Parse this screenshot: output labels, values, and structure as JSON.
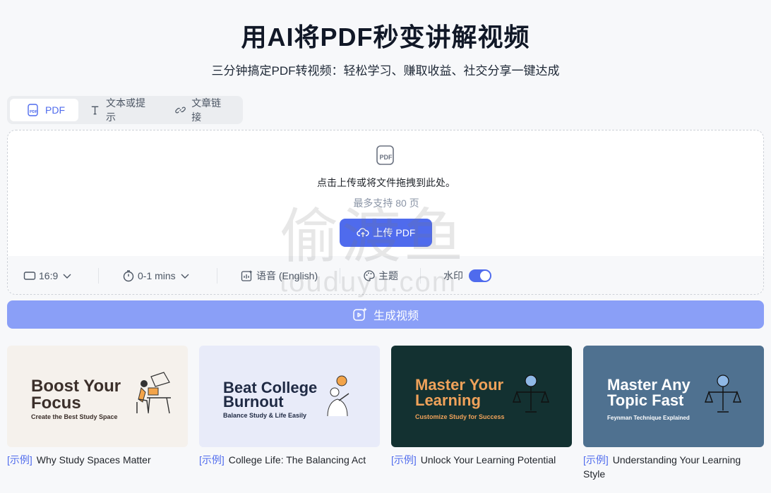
{
  "header": {
    "title": "用AI将PDF秒变讲解视频",
    "subtitle": "三分钟搞定PDF转视频：轻松学习、赚取收益、社交分享一键达成"
  },
  "tabs": [
    {
      "label": "PDF",
      "icon": "pdf-icon",
      "active": true
    },
    {
      "label": "文本或提示",
      "icon": "text-icon",
      "active": false
    },
    {
      "label": "文章链接",
      "icon": "link-icon",
      "active": false
    }
  ],
  "upload": {
    "instruction": "点击上传或将文件拖拽到此处。",
    "hint": "最多支持 80 页",
    "button_label": "上传 PDF"
  },
  "options": {
    "ratio": "16:9",
    "duration": "0-1 mins",
    "voice": "语音 (English)",
    "theme": "主题",
    "watermark_label": "水印",
    "watermark_on": true
  },
  "generate_label": "生成视频",
  "watermark_overlay": {
    "cn": "偷渡鱼",
    "en": "touduyu.com"
  },
  "examples": [
    {
      "tag": "[示例]",
      "caption": "Why Study Spaces Matter",
      "thumb_title_1": "Boost Your",
      "thumb_title_2": "Focus",
      "thumb_sub": "Create the Best Study Space",
      "bg": "#f5f1ec",
      "fg": "#3b2f2a"
    },
    {
      "tag": "[示例]",
      "caption": "College Life: The Balancing Act",
      "thumb_title_1": "Beat College",
      "thumb_title_2": "Burnout",
      "thumb_sub": "Balance Study & Life Easily",
      "bg": "#e8ebf9",
      "fg": "#1f2a44"
    },
    {
      "tag": "[示例]",
      "caption": "Unlock Your Learning Potential",
      "thumb_title_1": "Master Your",
      "thumb_title_2": "Learning",
      "thumb_sub": "Customize Study for Success",
      "bg": "#133131",
      "fg": "#f0a25a"
    },
    {
      "tag": "[示例]",
      "caption": "Understanding Your Learning Style",
      "thumb_title_1": "Master Any",
      "thumb_title_2": "Topic Fast",
      "thumb_sub": "Feynman Technique Explained",
      "bg": "#4f7190",
      "fg": "#ffffff"
    }
  ],
  "colors": {
    "accent": "#4f6bed",
    "generate_bg": "#8a9ff7"
  }
}
